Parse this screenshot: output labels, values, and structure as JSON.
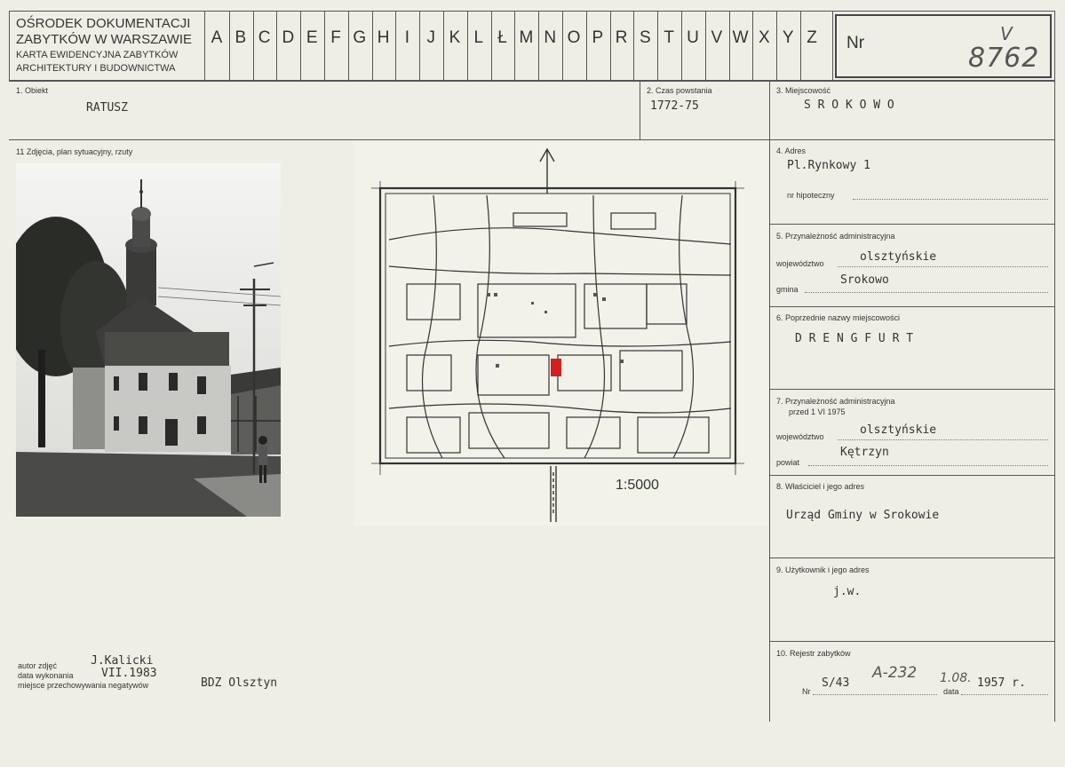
{
  "header": {
    "org_line1": "OŚRODEK DOKUMENTACJI",
    "org_line2": "ZABYTKÓW W WARSZAWIE",
    "org_line3": "KARTA EWIDENCYJNA ZABYTKÓW",
    "org_line4": "ARCHITEKTURY I BUDOWNICTWA",
    "letters": [
      "A",
      "B",
      "C",
      "D",
      "E",
      "F",
      "G",
      "H",
      "I",
      "J",
      "K",
      "L",
      "Ł",
      "M",
      "N",
      "O",
      "P",
      "R",
      "S",
      "T",
      "U",
      "V",
      "W",
      "X",
      "Y",
      "Z"
    ],
    "nr_label": "Nr",
    "nr_value": "8762",
    "nr_mark": "V"
  },
  "object": {
    "label": "1. Obiekt",
    "value": "RATUSZ"
  },
  "date": {
    "label": "2. Czas powstania",
    "value": "1772-75"
  },
  "place": {
    "label": "3. Miejscowość",
    "value": "S R O K O W O"
  },
  "photos": {
    "label": "11 Zdjęcia, plan sytuacyjny, rzuty",
    "scale": "1:5000"
  },
  "address": {
    "label": "4. Adres",
    "value": "Pl.Rynkowy 1",
    "mortgage_label": "nr hipoteczny"
  },
  "admin": {
    "label": "5. Przynależność administracyjna",
    "voiv_label": "województwo",
    "voiv_value": "olsztyńskie",
    "gmina_label": "gmina",
    "gmina_value": "Srokowo"
  },
  "former_names": {
    "label": "6. Poprzednie nazwy miejscowości",
    "value": "D R E N G F U R T"
  },
  "admin_before": {
    "label_line1": "7. Przynależność administracyjna",
    "label_line2": "przed 1 VI 1975",
    "voiv_label": "województwo",
    "voiv_value": "olsztyńskie",
    "powiat_label": "powiat",
    "powiat_value": "Kętrzyn"
  },
  "owner": {
    "label": "8. Właściciel i jego adres",
    "value": "Urząd Gminy w Srokowie"
  },
  "user": {
    "label": "9. Użytkownik i jego adres",
    "value": "j.w."
  },
  "register": {
    "label": "10. Rejestr zabytków",
    "nr_label": "Nr",
    "nr_value": "S/43",
    "nr_hand": "A-232",
    "date_hand": "1.08.",
    "date_value": "1957 r.",
    "date_label": "data"
  },
  "footer": {
    "author_label": "autor zdjęć",
    "author_value": "J.Kalicki",
    "date_label": "data wykonania",
    "date_value": "VII.1983",
    "storage_label": "miejsce przechowywania negatywów",
    "storage_value": "BDZ Olsztyn"
  },
  "colors": {
    "card": "#efeee6",
    "ink": "#333333",
    "highlight": "#d02020"
  }
}
